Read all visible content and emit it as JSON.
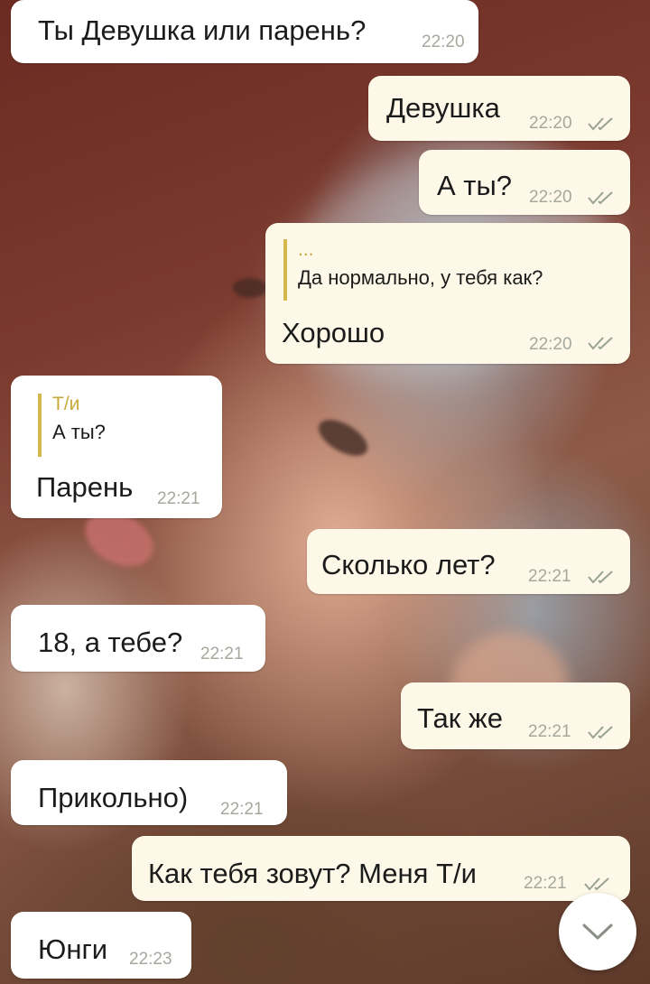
{
  "messages": [
    {
      "text": "Ты Девушка или парень?",
      "time": "22:20"
    },
    {
      "text": "Девушка",
      "time": "22:20"
    },
    {
      "text": "А ты?",
      "time": "22:20"
    },
    {
      "reply_author": "...",
      "reply_text": "Да нормально, у тебя как?",
      "text": "Хорошо",
      "time": "22:20"
    },
    {
      "reply_author": "Т/и",
      "reply_text": "А ты?",
      "text": "Парень",
      "time": "22:21"
    },
    {
      "text": "Сколько лет?",
      "time": "22:21"
    },
    {
      "text": "18, а тебе?",
      "time": "22:21"
    },
    {
      "text": "Так же",
      "time": "22:21"
    },
    {
      "text": "Прикольно)",
      "time": "22:21"
    },
    {
      "text": "Как тебя зовут? Меня Т/и",
      "time": "22:21"
    },
    {
      "text": "Юнги",
      "time": "22:23"
    }
  ],
  "colors": {
    "incoming_bubble": "#ffffff",
    "outgoing_bubble": "#fdf8e7",
    "reply_accent": "#d4b84a",
    "timestamp": "#a6a89e"
  },
  "icons": {
    "read_status": "double-check-icon",
    "scroll_down": "chevron-down-icon"
  }
}
